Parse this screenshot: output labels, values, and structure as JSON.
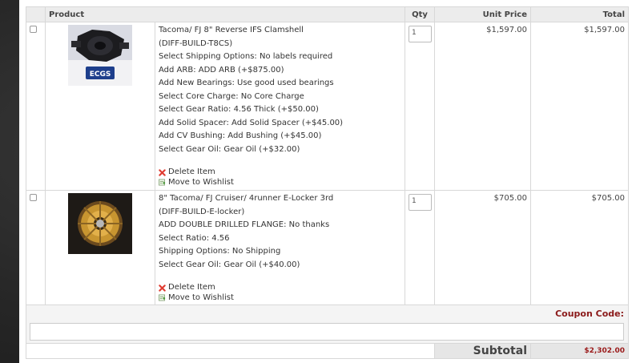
{
  "table": {
    "headers": {
      "product": "Product",
      "qty": "Qty",
      "unit_price": "Unit Price",
      "total": "Total"
    }
  },
  "items": [
    {
      "title": "Tacoma/ FJ 8\" Reverse IFS Clamshell",
      "sku": "(DIFF-BUILD-T8CS)",
      "options": [
        "Select Shipping Options: No labels required",
        "Add ARB: ADD ARB (+$875.00)",
        "Add New Bearings: Use good used bearings",
        "Select Core Charge: No Core Charge",
        "Select Gear Ratio: 4.56 Thick (+$50.00)",
        "Add Solid Spacer: Add Solid Spacer (+$45.00)",
        "Add CV Bushing: Add Bushing (+$45.00)",
        "Select Gear Oil: Gear Oil (+$32.00)"
      ],
      "delete_label": "Delete Item",
      "wishlist_label": "Move to Wishlist",
      "qty": "1",
      "unit_price": "$1,597.00",
      "total": "$1,597.00"
    },
    {
      "title": "8\" Tacoma/ FJ Cruiser/ 4runner E-Locker 3rd",
      "sku": "(DIFF-BUILD-E-locker)",
      "options": [
        "ADD DOUBLE DRILLED FLANGE: No thanks",
        "Select Ratio: 4.56",
        "Shipping Options: No Shipping",
        "Select Gear Oil: Gear Oil (+$40.00)"
      ],
      "delete_label": "Delete Item",
      "wishlist_label": "Move to Wishlist",
      "qty": "1",
      "unit_price": "$705.00",
      "total": "$705.00"
    }
  ],
  "coupon": {
    "label": "Coupon Code:",
    "value": ""
  },
  "subtotal": {
    "label": "Subtotal",
    "value": "$2,302.00"
  },
  "colors": {
    "accent": "#8b1a1a",
    "delete_icon": "#e03c31",
    "wishlist_icon": "#4a9a3a"
  },
  "icons": {
    "delete": "delete-x-icon",
    "wishlist": "wishlist-icon"
  }
}
